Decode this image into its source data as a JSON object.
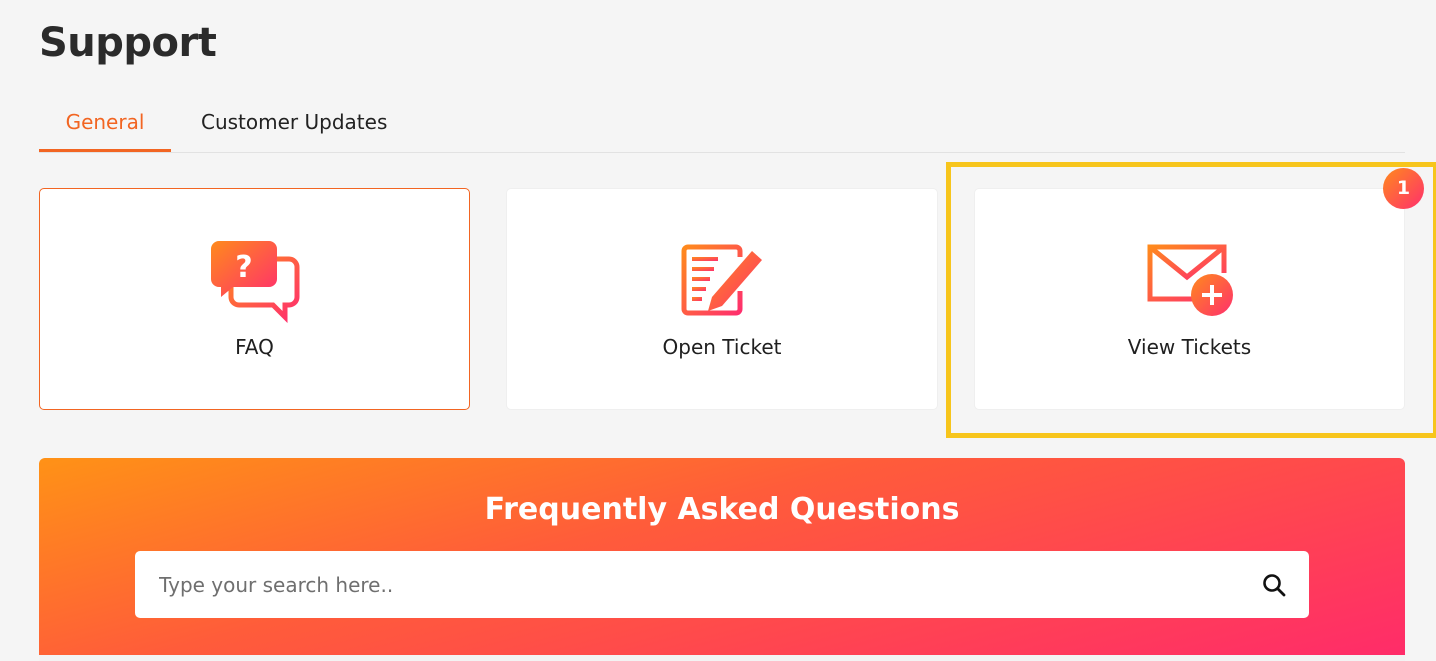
{
  "page": {
    "title": "Support"
  },
  "tabs": [
    {
      "label": "General",
      "active": true
    },
    {
      "label": "Customer Updates",
      "active": false
    }
  ],
  "cards": [
    {
      "label": "FAQ",
      "icon": "faq-chat-icon",
      "selected": true
    },
    {
      "label": "Open Ticket",
      "icon": "edit-form-icon",
      "selected": false
    },
    {
      "label": "View Tickets",
      "icon": "mail-plus-icon",
      "selected": false
    }
  ],
  "annotation": {
    "badge_number": "1",
    "highlight_color": "#f7c51c"
  },
  "faq_section": {
    "heading": "Frequently Asked Questions",
    "search_placeholder": "Type your search here..",
    "search_value": "",
    "search_icon": "search-icon"
  },
  "colors": {
    "accent": "#f26522",
    "gradient_start": "#ff9216",
    "gradient_end": "#ff2b6a",
    "background": "#f5f5f5"
  }
}
